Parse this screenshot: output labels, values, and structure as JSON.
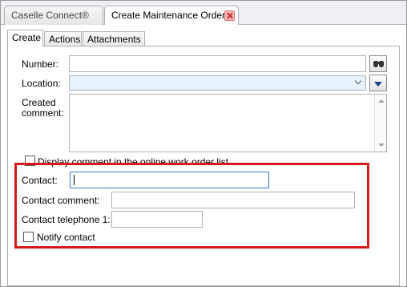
{
  "doc_tabs": [
    {
      "label": "Caselle Connect®"
    },
    {
      "label": "Create Maintenance Orders"
    }
  ],
  "inner_tabs": [
    {
      "label": "Create"
    },
    {
      "label": "Actions"
    },
    {
      "label": "Attachments"
    }
  ],
  "form": {
    "number_label": "Number:",
    "number_value": "",
    "location_label": "Location:",
    "location_value": "",
    "created_comment_label_1": "Created",
    "created_comment_label_2": "comment:",
    "created_comment_value": "",
    "display_comment_label": "Display comment in the online work order list",
    "contact_label": "Contact:",
    "contact_value": "",
    "contact_comment_label": "Contact comment:",
    "contact_comment_value": "",
    "contact_phone_label": "Contact telephone 1:",
    "contact_phone_value": "",
    "notify_contact_label": "Notify contact"
  },
  "colors": {
    "highlight": "#d7191c",
    "location_bg": "#e6f3fc",
    "contact_border": "#3d7bd1"
  }
}
